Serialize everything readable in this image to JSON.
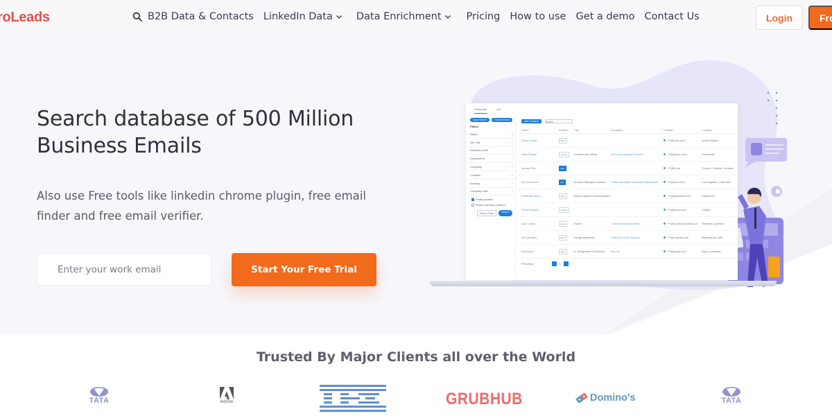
{
  "brand": {
    "name": "roLeads",
    "color": "#e0524b"
  },
  "colors": {
    "accent": "#f26a1b",
    "mockup_blue": "#1c7ed6",
    "illustration_purple": "#8b82e0"
  },
  "nav": {
    "search_icon": "search-icon",
    "items": [
      {
        "label": "B2B Data & Contacts",
        "has_dropdown": false
      },
      {
        "label": "LinkedIn Data",
        "has_dropdown": true
      },
      {
        "label": "Data Enrichment",
        "has_dropdown": true
      },
      {
        "label": "Pricing",
        "has_dropdown": false
      },
      {
        "label": "How to use",
        "has_dropdown": false
      },
      {
        "label": "Get a demo",
        "has_dropdown": false
      },
      {
        "label": "Contact Us",
        "has_dropdown": false
      }
    ],
    "login_label": "Login",
    "free_label": "Free"
  },
  "hero": {
    "title": "Search database of 500 Million Business Emails",
    "subtitle": "Also use Free tools like linkedin chrome plugin, free email finder and free email verifier.",
    "email_placeholder": "Enter your work email",
    "email_value": "",
    "cta_label": "Start Your Free Trial"
  },
  "mockup": {
    "tabs": [
      "Prospects",
      "List"
    ],
    "side_buttons": [
      "Save Search",
      "Saved Search"
    ],
    "filters_heading": "Filters",
    "filters": [
      "Name",
      "Job Title",
      "Seniority Level",
      "Department",
      "Company",
      "Location",
      "Industry",
      "Company Size"
    ],
    "checkboxes": [
      {
        "label": "Email present",
        "checked": true
      },
      {
        "label": "Phone numbers present",
        "checked": false
      }
    ],
    "reset_label": "Reset Filter",
    "search_label": "Search",
    "toolbar_button": "Add Contacts",
    "toolbar_select": "Action",
    "columns": [
      "Name",
      "Position",
      "Title",
      "Company",
      "Contact",
      "Location"
    ],
    "rows": [
      {
        "name": "Grace Foster",
        "tag": "Exec",
        "tag_blue": false,
        "title": "",
        "company": "",
        "contact": "***@corp.com",
        "location": "United States"
      },
      {
        "name": "Riley Powell",
        "tag": "Owner",
        "tag_blue": false,
        "title": "Commercial Officer",
        "company": "Pax International Partners",
        "contact": "***@yahoo.com",
        "location": "Cambodia"
      },
      {
        "name": "Jordan Ellis",
        "tag": "Mgr",
        "tag_blue": true,
        "title": "",
        "company": "",
        "contact": "***@im.ca",
        "location": "Toronto, Ontario, Canada"
      },
      {
        "name": "Lee Anderson",
        "tag": "Dir",
        "tag_blue": true,
        "title": "Student Manager, Director",
        "company": "California State University, Bakersfield",
        "contact": "***@csub.edu",
        "location": "Los Angeles, California"
      },
      {
        "name": "Frederick Dixon",
        "tag": "Exec",
        "tag_blue": false,
        "title": "Senior Systems Administrator",
        "company": "",
        "contact": "***@globalnet.com",
        "location": "Vancouver"
      },
      {
        "name": "Pierce Bowen",
        "tag": "Owner",
        "tag_blue": false,
        "title": "",
        "company": "",
        "contact": "***@icloud.com",
        "location": "Turkey"
      },
      {
        "name": "Cam Linder",
        "tag": "Exec",
        "tag_blue": false,
        "title": "Owner",
        "company": "Communications Direct",
        "contact": "***@communications.ca",
        "location": "Montreal, Quebec"
      },
      {
        "name": "Kim Morales",
        "tag": "Exec",
        "tag_blue": false,
        "title": "Paraprofessional",
        "company": "Anaheim Union School",
        "contact": "***@hotmail.com",
        "location": "Minneapolis, MN"
      },
      {
        "name": "Neil Bruce",
        "tag": "Exec",
        "tag_blue": false,
        "title": "Jr. IB Aground Technician",
        "company": "Min Inc.",
        "contact": "***@gmail.com",
        "location": "Italy, Lombardy"
      }
    ],
    "pager_label": "Prev/Next",
    "page": "1"
  },
  "clients": {
    "title": "Trusted By Major Clients all over the World",
    "logos": [
      "TATA",
      "Adobe",
      "IBM",
      "GRUBHUB",
      "Domino's",
      "TATA"
    ]
  }
}
